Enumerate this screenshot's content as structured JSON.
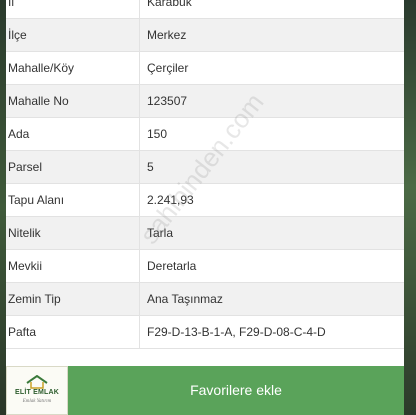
{
  "rows": [
    {
      "label": "İl",
      "value": "Karabük"
    },
    {
      "label": "İlçe",
      "value": "Merkez"
    },
    {
      "label": "Mahalle/Köy",
      "value": "Çerçiler"
    },
    {
      "label": "Mahalle No",
      "value": "123507"
    },
    {
      "label": "Ada",
      "value": "150"
    },
    {
      "label": "Parsel",
      "value": "5"
    },
    {
      "label": "Tapu Alanı",
      "value": "2.241,93"
    },
    {
      "label": "Nitelik",
      "value": "Tarla"
    },
    {
      "label": "Mevkii",
      "value": "Deretarla"
    },
    {
      "label": "Zemin Tip",
      "value": "Ana Taşınmaz"
    },
    {
      "label": "Pafta",
      "value": "F29-D-13-B-1-A, F29-D-08-C-4-D"
    }
  ],
  "watermark": "sahibinden.com",
  "action": {
    "label": "Favorilere ekle"
  },
  "logo": {
    "name": "ELİT EMLAK",
    "tagline": "Emlak Yatırım",
    "icon": "house-icon"
  },
  "colors": {
    "button": "#5aa35a",
    "row_alt": "#f1f1f1",
    "logo_text": "#2d5d2d"
  }
}
